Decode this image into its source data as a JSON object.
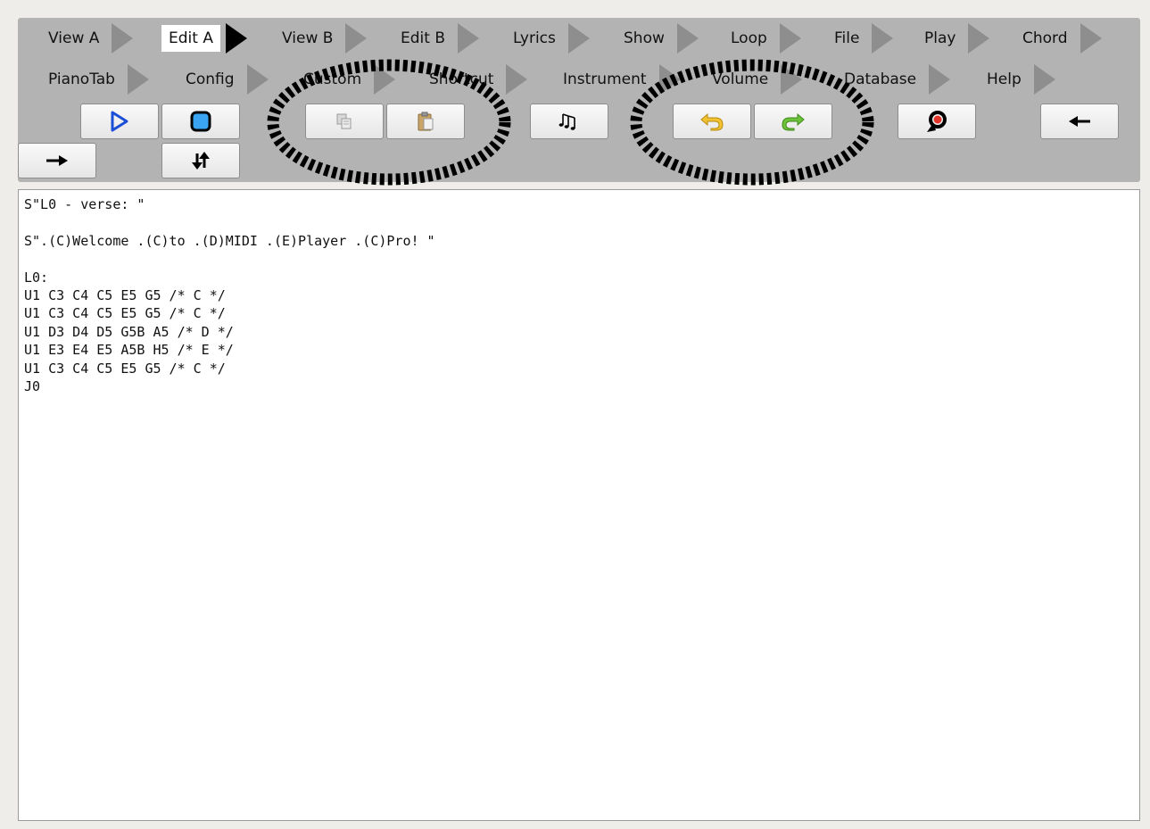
{
  "menu": {
    "row1": [
      {
        "label": "View A",
        "active": false
      },
      {
        "label": "Edit A",
        "active": true
      },
      {
        "label": "View B",
        "active": false
      },
      {
        "label": "Edit B",
        "active": false
      },
      {
        "label": "Lyrics",
        "active": false
      },
      {
        "label": "Show",
        "active": false
      },
      {
        "label": "Loop",
        "active": false
      },
      {
        "label": "File",
        "active": false
      },
      {
        "label": "Play",
        "active": false
      },
      {
        "label": "Chord",
        "active": false
      }
    ],
    "row2": [
      {
        "label": "PianoTab",
        "active": false
      },
      {
        "label": "Config",
        "active": false
      },
      {
        "label": "Custom",
        "active": false
      },
      {
        "label": "Shortcut",
        "active": false
      },
      {
        "label": "Instrument",
        "active": false
      },
      {
        "label": "Volume",
        "active": false
      },
      {
        "label": "Database",
        "active": false
      },
      {
        "label": "Help",
        "active": false
      }
    ]
  },
  "buttons": {
    "play": "play-icon",
    "stop": "stop-icon",
    "copy": "copy-icon",
    "paste": "paste-icon",
    "notes": "music-notes-icon",
    "undo": "undo-icon",
    "redo": "redo-icon",
    "rewind": "rewind-icon",
    "back": "arrow-left-icon",
    "forward": "arrow-right-icon",
    "swap": "swap-arrows-icon"
  },
  "colors": {
    "toolbar": "#b3b3b3",
    "play_icon": "#1a4fd6",
    "stop_icon": "#3aa4f2",
    "undo_icon": "#f2c230",
    "redo_icon": "#6cc23a"
  },
  "editor": {
    "text": "S\"L0 - verse: \"\n\nS\".(C)Welcome .(C)to .(D)MIDI .(E)Player .(C)Pro! \"\n\nL0:\nU1 C3 C4 C5 E5 G5 /* C */\nU1 C3 C4 C5 E5 G5 /* C */\nU1 D3 D4 D5 G5B A5 /* D */\nU1 E3 E4 E5 A5B H5 /* E */\nU1 C3 C4 C5 E5 G5 /* C */\nJ0"
  }
}
